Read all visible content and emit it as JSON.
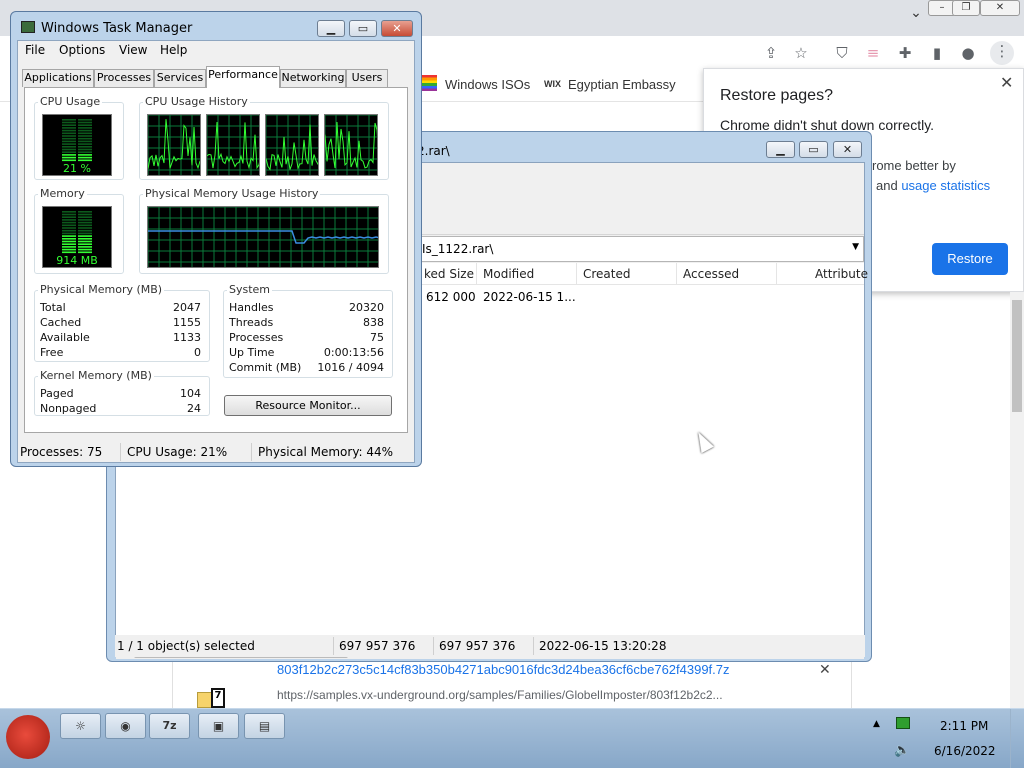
{
  "chrome": {
    "bookmarks": [
      {
        "label": "Windows ISOs"
      },
      {
        "label": "Egyptian Embassy",
        "prefix": "WIX"
      }
    ],
    "restore": {
      "title": "Restore pages?",
      "message": "Chrome didn't shut down correctly.",
      "partial_line1": "rome better by",
      "partial_line2_pre": "and ",
      "partial_line2_link": "usage statistics",
      "button": "Restore"
    },
    "download": {
      "name": "803f12b2c273c5c14cf83b350b4271abc9016fdc3d24bea36cf6cbe762f4399f.7z",
      "url": "https://samples.vx-underground.org/samples/Families/GlobelImposter/803f12b2c2..."
    }
  },
  "zip": {
    "title_partial": "2.rar\\",
    "address_partial": "Is_1122.rar\\",
    "columns": [
      "ked Size",
      "Modified",
      "Created",
      "Accessed",
      "Attribute"
    ],
    "rows": [
      {
        "packed": "612 000",
        "modified": "2022-06-15 1...",
        "created": "",
        "accessed": "",
        "attributes": ""
      }
    ],
    "status": {
      "selection": "1 / 1 object(s) selected",
      "size": "697 957 376",
      "packed": "697 957 376",
      "modified": "2022-06-15 13:20:28"
    }
  },
  "taskmgr": {
    "title": "Windows Task Manager",
    "menu": [
      "File",
      "Options",
      "View",
      "Help"
    ],
    "tabs": [
      "Applications",
      "Processes",
      "Services",
      "Performance",
      "Networking",
      "Users"
    ],
    "active_tab": "Performance",
    "cpu_usage_label": "CPU Usage",
    "cpu_usage_value": "21 %",
    "cpu_usage_fraction": 0.21,
    "cpu_history_label": "CPU Usage History",
    "memory_label": "Memory",
    "memory_value": "914 MB",
    "memory_fraction": 0.44,
    "phys_history_label": "Physical Memory Usage History",
    "physical_memory": {
      "label": "Physical Memory (MB)",
      "rows": [
        {
          "k": "Total",
          "v": "2047"
        },
        {
          "k": "Cached",
          "v": "1155"
        },
        {
          "k": "Available",
          "v": "1133"
        },
        {
          "k": "Free",
          "v": "0"
        }
      ]
    },
    "kernel_memory": {
      "label": "Kernel Memory (MB)",
      "rows": [
        {
          "k": "Paged",
          "v": "104"
        },
        {
          "k": "Nonpaged",
          "v": "24"
        }
      ]
    },
    "system": {
      "label": "System",
      "rows": [
        {
          "k": "Handles",
          "v": "20320"
        },
        {
          "k": "Threads",
          "v": "838"
        },
        {
          "k": "Processes",
          "v": "75"
        },
        {
          "k": "Up Time",
          "v": "0:00:13:56"
        },
        {
          "k": "Commit (MB)",
          "v": "1016 / 4094"
        }
      ]
    },
    "resource_monitor_button": "Resource Monitor...",
    "status": {
      "processes": "Processes: 75",
      "cpu": "CPU Usage: 21%",
      "memory": "Physical Memory: 44%"
    }
  },
  "taskbar": {
    "time": "2:11 PM",
    "date": "6/16/2022",
    "buttons": [
      {
        "icon": "explorer-icon",
        "label": "☼"
      },
      {
        "icon": "chrome-icon",
        "label": "◉"
      },
      {
        "icon": "7zip-icon",
        "label": "7z"
      },
      {
        "icon": "taskmgr-icon",
        "label": "▣"
      },
      {
        "icon": "notepad-icon",
        "label": "▤"
      }
    ]
  },
  "colors": {
    "chrome_blue": "#1a73e8",
    "meter_green": "#33ff33",
    "graph_grid": "#0a7a3a",
    "mem_line": "#3b8de0"
  }
}
